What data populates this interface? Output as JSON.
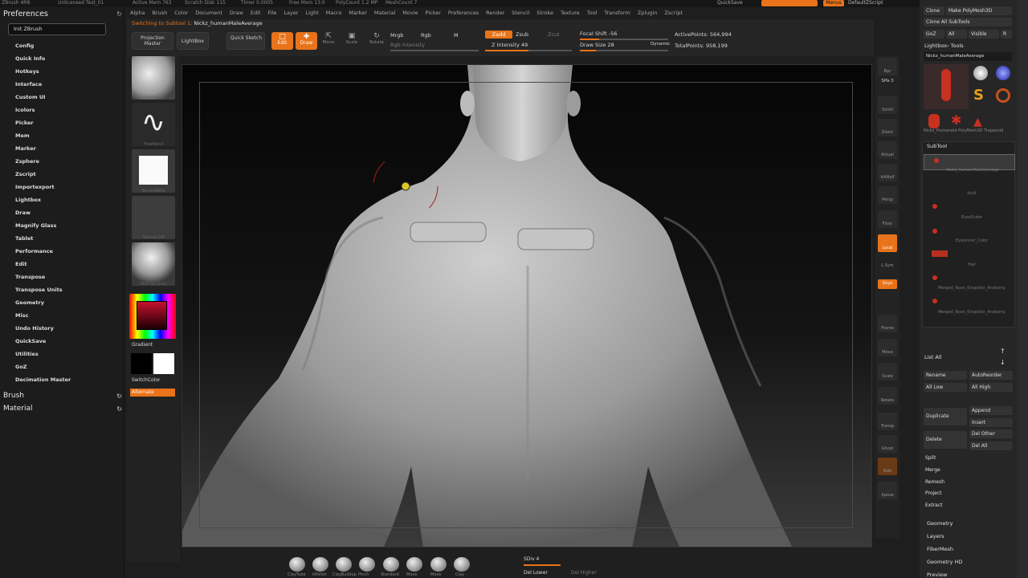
{
  "top": {
    "strip_items": [
      "ZBrush 4R8",
      "Unlicensed Test_01",
      "Active Mem 763",
      "Scratch Disk 115",
      "Timer 0.0005",
      "Free Mem 13.0",
      "PolyCount 1.2 MP",
      "MeshCount 7"
    ],
    "menu": [
      "Alpha",
      "Brush",
      "Color",
      "Document",
      "Draw",
      "Edit",
      "File",
      "Layer",
      "Light",
      "Macro",
      "Marker",
      "Material",
      "Movie",
      "Picker",
      "Preferences",
      "Render",
      "Stencil",
      "Stroke",
      "Texture",
      "Tool",
      "Transform",
      "Zplugin",
      "Zscript"
    ],
    "quicksave": "QuickSave",
    "menus_label": "Menus",
    "default_script": "DefaultZScript"
  },
  "left_panel": {
    "title": "Preferences",
    "init_button": "Init ZBrush",
    "items": [
      "Config",
      "Quick Info",
      "Hotkeys",
      "Interface",
      "Custom UI",
      "Icolors",
      "Picker",
      "Mem",
      "Marker",
      "Zsphere",
      "Zscript",
      "Importexport",
      "Lightbox",
      "Draw",
      "Magnify Glass",
      "Tablet",
      "Performance",
      "Edit",
      "Transpose",
      "Transpose Units",
      "Geometry",
      "Misc",
      "Undo History",
      "QuickSave",
      "Utilities",
      "GoZ",
      "Decimation Master"
    ],
    "sections": [
      "Brush",
      "Material"
    ]
  },
  "toolbar": {
    "notice_prefix": "Switching to Subtool 1:",
    "notice_name": "Nickz_humanMaleAverage",
    "projection_master": "Projection Master",
    "lightbox": "LightBox",
    "quick_sketch": "Quick Sketch",
    "edit": "Edit",
    "draw": "Draw",
    "move": "Move",
    "scale": "Scale",
    "rotate": "Rotate",
    "mrgb": "Mrgb",
    "rgb": "Rgb",
    "m": "M",
    "rgb_intensity": "Rgb Intensity",
    "zadd": "Zadd",
    "zsub": "Zsub",
    "zcut": "Zcut",
    "z_intensity": "Z Intensity 49",
    "focal_shift": "Focal Shift -56",
    "draw_size": "Draw Size 28",
    "dynamic": "Dynamic",
    "active_points": "ActivePoints: 564,994",
    "total_points": "TotalPoints: 958,199"
  },
  "palette": {
    "thumbs": [
      "ClayTubes",
      "FreeHand",
      "BrushAlpha",
      "Texture Off",
      "MatCap Gray"
    ],
    "gradient": "Gradient",
    "switch_color": "SwitchColor",
    "alternate": "Alternate",
    "color_main": "#c8102e"
  },
  "right_shelf": [
    "Bpr",
    "SPix 3",
    "Scroll",
    "Zoom",
    "Actual",
    "AAHalf",
    "Persp",
    "Floor",
    "Local",
    "L.Sym",
    "Gxyz",
    "Frame",
    "Move",
    "Scale",
    "Rotate",
    "Transp",
    "Ghost",
    "Solo",
    "Xpose"
  ],
  "right_panel": {
    "top_buttons": [
      "Clone",
      "Make PolyMesh3D"
    ],
    "clone_all": "Clone All SubTools",
    "goz": "GoZ",
    "all": "All",
    "visible": "Visible",
    "r": "R",
    "lightbox_tools": "Lightbox› Tools",
    "current_tool": "Nickz_humanMaleAverage",
    "tool_thumbs": [
      "Nickz_humanMaleAverage",
      "SphereBrush",
      "AlphaBrush",
      "SimpleBrush",
      "EraserBrush",
      "Nickz_Humanoid",
      "PolyMesh3D",
      "Trapezoid"
    ],
    "subtool_label": "SubTool",
    "subtools": [
      "Nickz_humanMaleAverage",
      "skull",
      "EyesOuter",
      "EyesInner_Color",
      "Hair",
      "Merged_Ryan_Kingslien_Anatomy",
      "Merged_Ryan_Kingslien_Anatomy"
    ],
    "list_all": "List All",
    "rename": "Rename",
    "autoreorder": "AutoReorder",
    "all_low": "All Low",
    "all_high": "All High",
    "duplicate": "Duplicate",
    "append": "Append",
    "insert": "Insert",
    "delete": "Delete",
    "del_other": "Del Other",
    "del_all": "Del All",
    "split": "Split",
    "merge": "Merge",
    "remesh": "Remesh",
    "project": "Project",
    "extract": "Extract",
    "bottom_sections": [
      "Geometry",
      "Layers",
      "FiberMesh",
      "Geometry HD",
      "Preview"
    ]
  },
  "bottom": {
    "brushes": [
      "ClayTube",
      "hPolish",
      "ClayBuildup",
      "Pinch",
      "Standard",
      "Move",
      "Inflat",
      "Move",
      "Clay"
    ],
    "sdiv": "SDiv 4",
    "del_lower": "Del Lower",
    "del_higher": "Del Higher"
  },
  "colors": {
    "accent": "#e8731a",
    "panel": "#262626"
  }
}
